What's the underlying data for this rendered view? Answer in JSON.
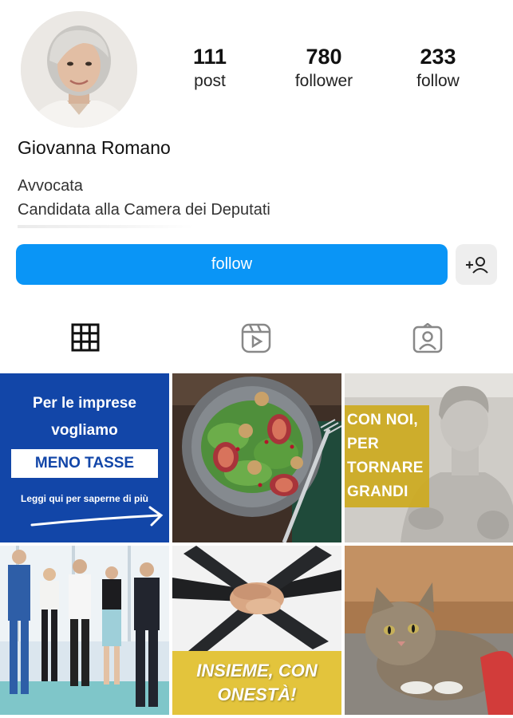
{
  "profile": {
    "name": "Giovanna Romano",
    "bio_line1": "Avvocata",
    "bio_line2": "Candidata alla Camera dei Deputati"
  },
  "stats": [
    {
      "value": "111",
      "label": "post"
    },
    {
      "value": "780",
      "label": "follower"
    },
    {
      "value": "233",
      "label": "follow"
    }
  ],
  "actions": {
    "follow_label": "follow"
  },
  "tabs": [
    {
      "icon": "grid-icon",
      "active": true
    },
    {
      "icon": "reels-icon",
      "active": false
    },
    {
      "icon": "tagged-icon",
      "active": false
    }
  ],
  "posts": {
    "p1": {
      "line1": "Per le imprese",
      "line2": "vogliamo",
      "highlight": "MENO TASSE",
      "cta": "Leggi qui per saperne di più"
    },
    "p3": {
      "lines": [
        "CON NOI,",
        "PER",
        "TORNARE",
        "GRANDI"
      ]
    },
    "p5": {
      "line1": "INSIEME, CON",
      "line2": "ONESTÀ!"
    }
  },
  "colors": {
    "follow_button": "#0a95f6",
    "post1_blue": "#1246a8",
    "post3_gold": "#cdaa1e",
    "post5_yellow": "#e3c43c"
  }
}
